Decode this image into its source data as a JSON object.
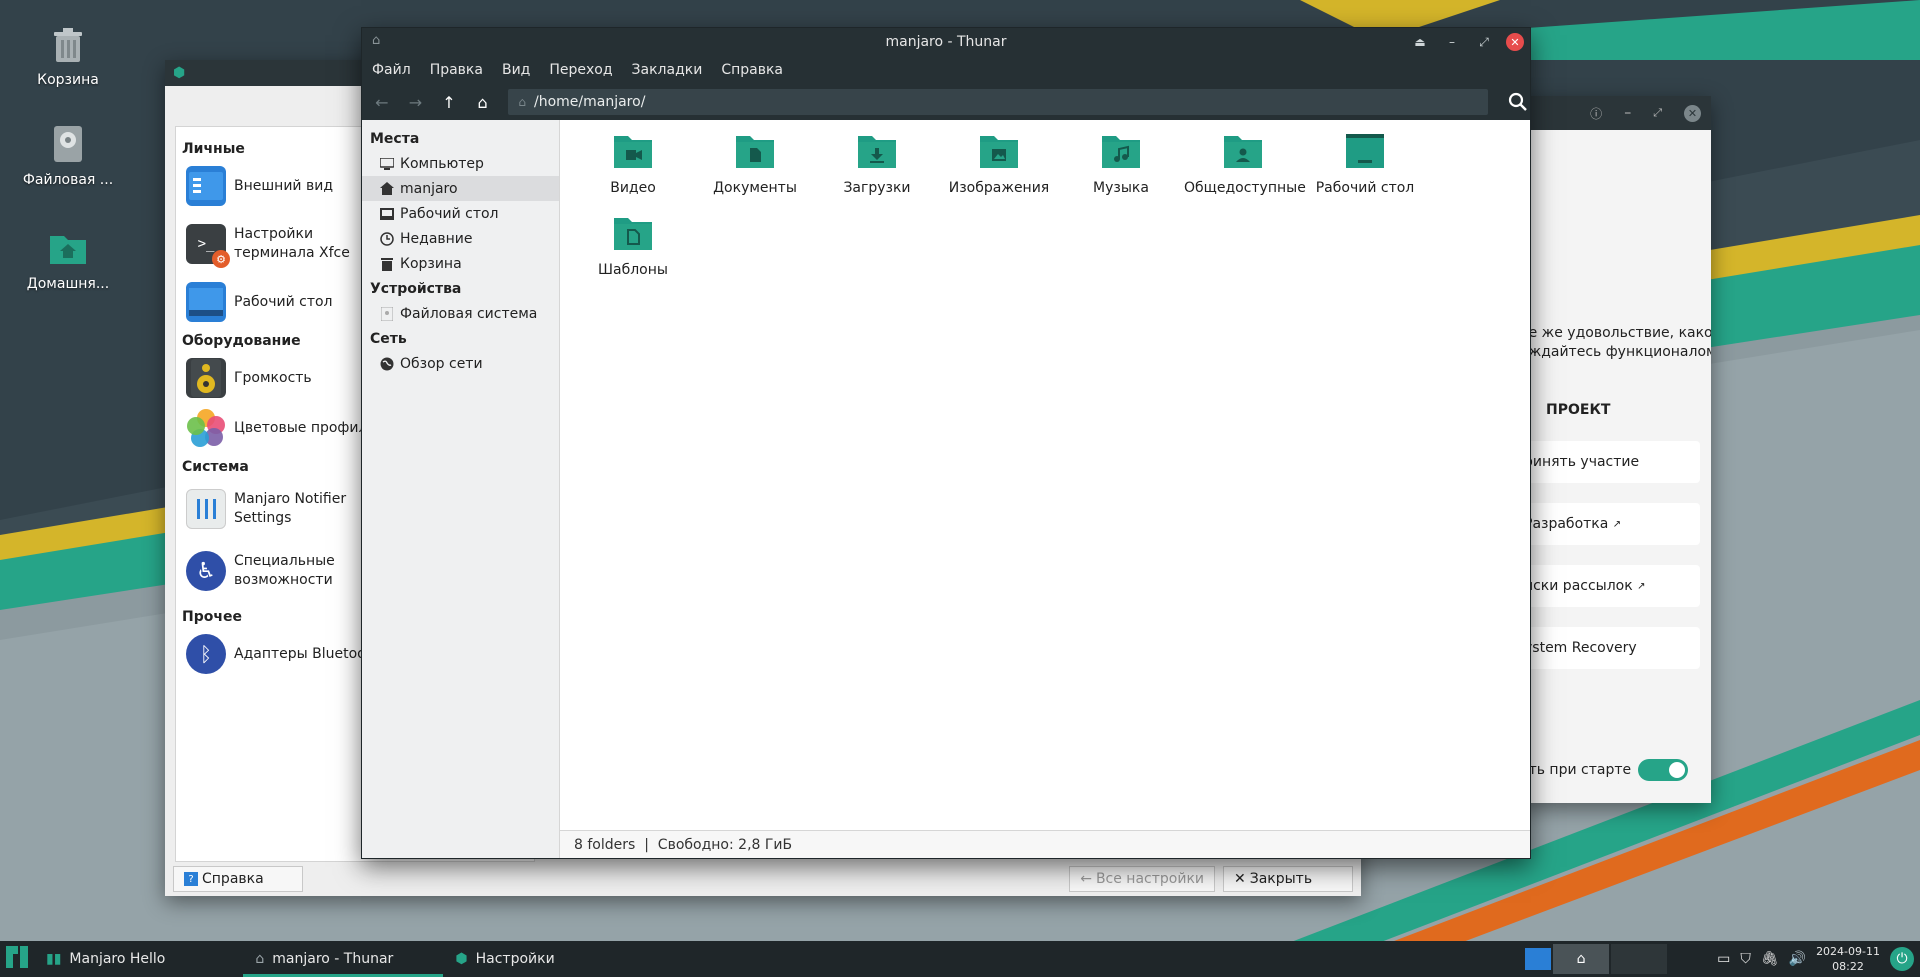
{
  "desktop": {
    "icons": [
      {
        "label": "Корзина",
        "icon": "trash-icon"
      },
      {
        "label": "Файловая ...",
        "icon": "drive-icon"
      },
      {
        "label": "Домашня...",
        "icon": "home-folder-icon"
      }
    ]
  },
  "settings": {
    "groups": {
      "personal": "Личные",
      "hardware": "Оборудование",
      "system": "Система",
      "other": "Прочее"
    },
    "items": {
      "appearance": "Внешний вид",
      "terminal_1": "Настройки",
      "terminal_2": "терминала Xfce",
      "desktop": "Рабочий стол",
      "volume": "Громкость",
      "color_profiles": "Цветовые профили",
      "notifier_1": "Manjaro Notifier",
      "notifier_2": "Settings",
      "accessibility_1": "Специальные",
      "accessibility_2": "возможности",
      "bluetooth": "Адаптеры Bluetooth"
    },
    "footer": {
      "help": "Справка",
      "all_settings": "Все настройки",
      "close": "Закрыть"
    }
  },
  "hello": {
    "text_line1": "ое же удовольствие, какое",
    "text_line2": "аждайтесь функционалом",
    "project_heading": "ПРОЕКТ",
    "cards": [
      "ринять участие",
      "Разработка",
      "иски рассылок",
      "ystem Recovery"
    ],
    "startup_label": "ать при старте",
    "startup_enabled": true
  },
  "thunar": {
    "title": "manjaro - Thunar",
    "menu": [
      "Файл",
      "Правка",
      "Вид",
      "Переход",
      "Закладки",
      "Справка"
    ],
    "path": "/home/manjaro/",
    "sidebar": {
      "places_heading": "Места",
      "places": [
        "Компьютер",
        "manjaro",
        "Рабочий стол",
        "Недавние",
        "Корзина"
      ],
      "devices_heading": "Устройства",
      "devices": [
        "Файловая система"
      ],
      "network_heading": "Сеть",
      "network": [
        "Обзор сети"
      ]
    },
    "folders": [
      {
        "label": "Видео",
        "icon": "video-folder-icon"
      },
      {
        "label": "Документы",
        "icon": "documents-folder-icon"
      },
      {
        "label": "Загрузки",
        "icon": "downloads-folder-icon"
      },
      {
        "label": "Изображения",
        "icon": "pictures-folder-icon"
      },
      {
        "label": "Музыка",
        "icon": "music-folder-icon"
      },
      {
        "label": "Общедоступные",
        "icon": "public-folder-icon"
      },
      {
        "label": "Рабочий стол",
        "icon": "desktop-folder-icon"
      },
      {
        "label": "Шаблоны",
        "icon": "templates-folder-icon"
      }
    ],
    "status": "8 folders  |  Свободно: 2,8 ГиБ"
  },
  "taskbar": {
    "tasks": [
      "Manjaro Hello",
      "manjaro - Thunar",
      "Настройки"
    ],
    "active_task": "manjaro - Thunar",
    "date": "2024-09-11",
    "time": "08:22"
  },
  "colors": {
    "accent": "#26a488",
    "titlebar": "#263034",
    "close": "#e74c4c",
    "folder": "#1f9c84"
  }
}
